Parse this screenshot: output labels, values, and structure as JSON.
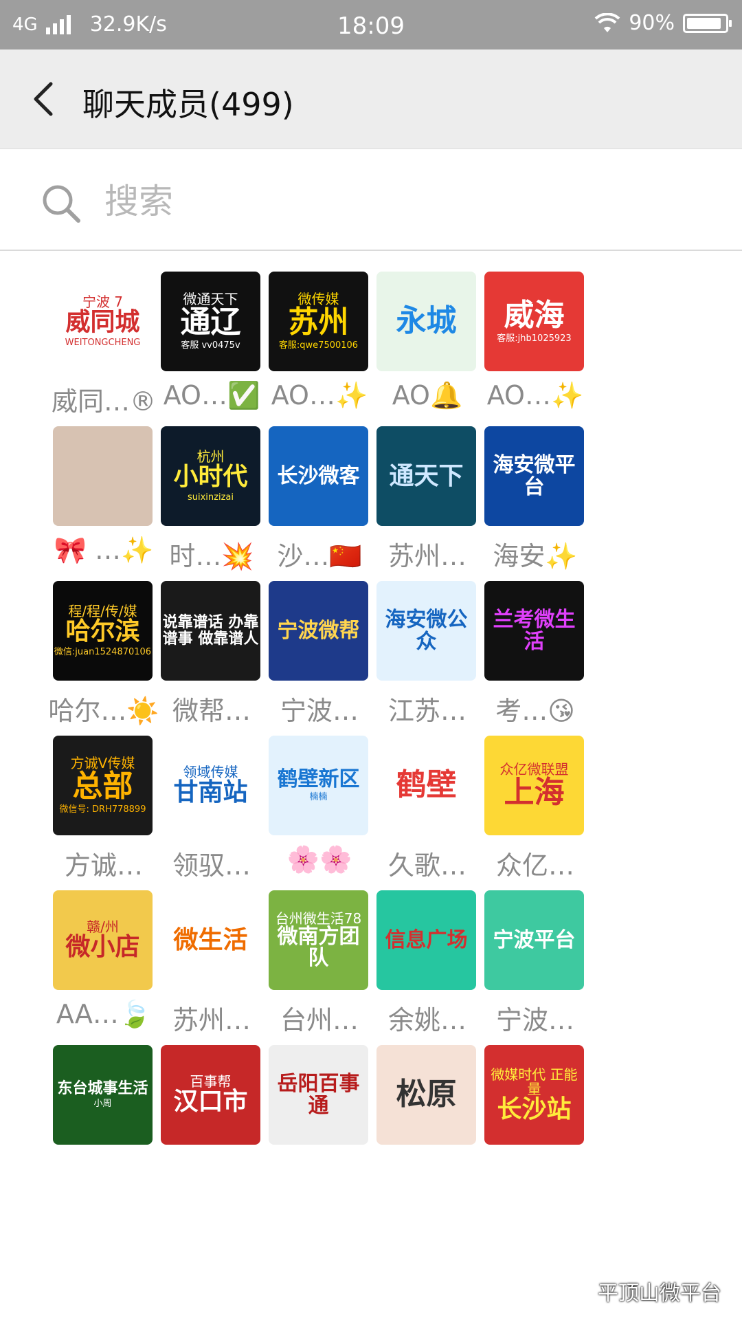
{
  "status_bar": {
    "network": "4G",
    "speed": "32.9K/s",
    "time": "18:09",
    "battery": "90%",
    "battery_level": 0.9
  },
  "header": {
    "back_icon": "chevron-left-icon",
    "title": "聊天成员(499)"
  },
  "search": {
    "icon": "search-icon",
    "placeholder": "搜索"
  },
  "members": [
    {
      "name": "威同…®",
      "avatar": {
        "top": "宁波 7",
        "main": "威同城",
        "sub": "WEITONGCHENG",
        "bg": "#ffffff",
        "color": "#d32f2f"
      }
    },
    {
      "name": "AO…✅",
      "avatar": {
        "top": "微通天下",
        "main": "通辽",
        "sub": "客服 vv0475v",
        "bg": "#101010",
        "color": "#ffffff"
      }
    },
    {
      "name": "AO…✨",
      "avatar": {
        "top": "微传媒",
        "main": "苏州",
        "sub": "客服:qwe7500106",
        "bg": "#111111",
        "color": "#ffd600"
      }
    },
    {
      "name": "AO🔔",
      "avatar": {
        "top": "",
        "main": "永城",
        "sub": "",
        "bg": "#e8f5e9",
        "color": "#1e88e5"
      }
    },
    {
      "name": "AO…✨",
      "avatar": {
        "top": "",
        "main": "威海",
        "sub": "客服:jhb1025923",
        "bg": "#e53935",
        "color": "#ffffff"
      }
    },
    {
      "name": "🎀 …✨",
      "avatar": {
        "top": "",
        "main": "",
        "sub": "",
        "bg": "#d7c2b2",
        "color": "#ffffff"
      }
    },
    {
      "name": "时…💥",
      "avatar": {
        "top": "杭州",
        "main": "小时代",
        "sub": "suixinzizai",
        "bg": "#0d1b2a",
        "color": "#ffeb3b"
      }
    },
    {
      "name": "沙…🇨🇳",
      "avatar": {
        "top": "",
        "main": "长沙微客",
        "sub": "",
        "bg": "#1565c0",
        "color": "#ffffff"
      }
    },
    {
      "name": "苏州…",
      "avatar": {
        "top": "",
        "main": "通天下",
        "sub": "",
        "bg": "#0e4d64",
        "color": "#cfe8ff"
      }
    },
    {
      "name": "海安✨",
      "avatar": {
        "top": "",
        "main": "海安微平台",
        "sub": "",
        "bg": "#0d47a1",
        "color": "#ffffff"
      }
    },
    {
      "name": "哈尔…☀️",
      "avatar": {
        "top": "程/程/传/媒",
        "main": "哈尔滨",
        "sub": "微信:juan1524870106",
        "bg": "#0a0a0a",
        "color": "#ffca28"
      }
    },
    {
      "name": "微帮…",
      "avatar": {
        "top": "",
        "main": "说靠谱话 办靠谱事 做靠谱人",
        "sub": "",
        "bg": "#1a1a1a",
        "color": "#ffffff"
      }
    },
    {
      "name": "宁波…",
      "avatar": {
        "top": "",
        "main": "宁波微帮",
        "sub": "",
        "bg": "#1e3a8a",
        "color": "#ffd54f"
      }
    },
    {
      "name": "江苏…",
      "avatar": {
        "top": "",
        "main": "海安微公众",
        "sub": "",
        "bg": "#e3f2fd",
        "color": "#1565c0"
      }
    },
    {
      "name": "考…😘",
      "avatar": {
        "top": "",
        "main": "兰考微生活",
        "sub": "",
        "bg": "#111111",
        "color": "#e040fb"
      }
    },
    {
      "name": "方诚…",
      "avatar": {
        "top": "方诚V传媒",
        "main": "总部",
        "sub": "微信号: DRH778899",
        "bg": "#1a1a1a",
        "color": "#ffb300"
      }
    },
    {
      "name": "领驭…",
      "avatar": {
        "top": "领域传媒",
        "main": "甘南站",
        "sub": "",
        "bg": "#ffffff",
        "color": "#1565c0"
      }
    },
    {
      "name": "🌸🌸",
      "avatar": {
        "top": "",
        "main": "鹤壁新区",
        "sub": "楠楠",
        "bg": "#e3f2fd",
        "color": "#1976d2"
      }
    },
    {
      "name": "久歌…",
      "avatar": {
        "top": "",
        "main": "鹤壁",
        "sub": "",
        "bg": "#ffffff",
        "color": "#e53935"
      }
    },
    {
      "name": "众亿…",
      "avatar": {
        "top": "众亿微联盟",
        "main": "上海",
        "sub": "",
        "bg": "#fdd835",
        "color": "#d32f2f"
      }
    },
    {
      "name": "AA…🍃",
      "avatar": {
        "top": "赣/州",
        "main": "微小店",
        "sub": "",
        "bg": "#f2c94c",
        "color": "#c62828"
      }
    },
    {
      "name": "苏州…",
      "avatar": {
        "top": "",
        "main": "微生活",
        "sub": "",
        "bg": "#ffffff",
        "color": "#ef6c00"
      }
    },
    {
      "name": "台州…",
      "avatar": {
        "top": "台州微生活78",
        "main": "微南方团队",
        "sub": "",
        "bg": "#7cb342",
        "color": "#ffffff"
      }
    },
    {
      "name": "余姚…",
      "avatar": {
        "top": "",
        "main": "信息广场",
        "sub": "",
        "bg": "#26c6a0",
        "color": "#d32f2f"
      }
    },
    {
      "name": "宁波…",
      "avatar": {
        "top": "",
        "main": "宁波平台",
        "sub": "",
        "bg": "#3ec9a0",
        "color": "#ffffff"
      }
    },
    {
      "name": "",
      "avatar": {
        "top": "",
        "main": "东台城事生活",
        "sub": "小周",
        "bg": "#1b5e20",
        "color": "#ffffff"
      }
    },
    {
      "name": "",
      "avatar": {
        "top": "百事帮",
        "main": "汉口市",
        "sub": "",
        "bg": "#c62828",
        "color": "#ffffff"
      }
    },
    {
      "name": "",
      "avatar": {
        "top": "",
        "main": "岳阳百事通",
        "sub": "",
        "bg": "#eeeeee",
        "color": "#b71c1c"
      }
    },
    {
      "name": "",
      "avatar": {
        "top": "",
        "main": "松原",
        "sub": "",
        "bg": "#f5e1d6",
        "color": "#333333"
      }
    },
    {
      "name": "",
      "avatar": {
        "top": "微媒时代 正能量",
        "main": "长沙站",
        "sub": "",
        "bg": "#d32f2f",
        "color": "#ffeb3b"
      }
    }
  ],
  "watermark": "平顶山微平台"
}
